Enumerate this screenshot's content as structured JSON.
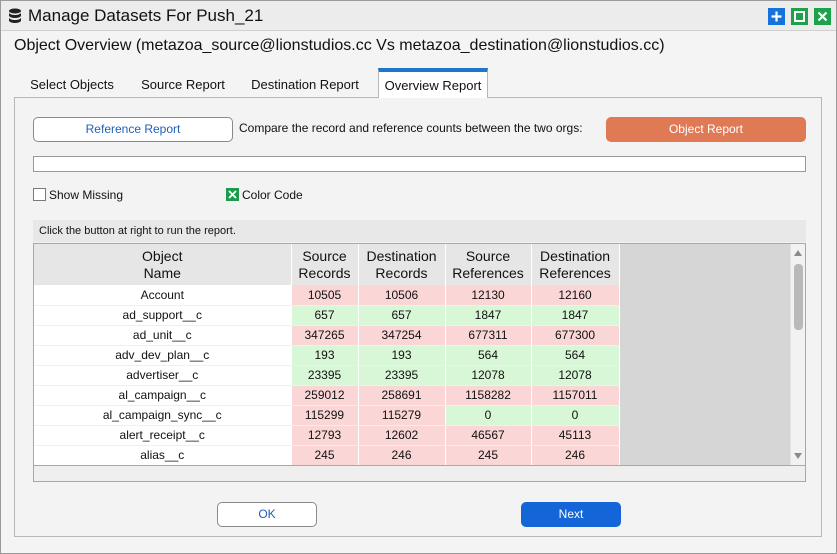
{
  "window": {
    "title": "Manage Datasets For Push_21"
  },
  "header": {
    "title": "Object Overview (metazoa_source@lionstudios.cc Vs metazoa_destination@lionstudios.cc)"
  },
  "tabs": [
    {
      "label": "Select Objects",
      "active": false
    },
    {
      "label": "Source Report",
      "active": false
    },
    {
      "label": "Destination Report",
      "active": false
    },
    {
      "label": "Overview Report",
      "active": true
    }
  ],
  "actions": {
    "reference_report_label": "Reference Report",
    "description": "Compare the record and reference counts between the two orgs:",
    "object_report_label": "Object Report"
  },
  "progress": {
    "value_percent": 0
  },
  "options": {
    "show_missing": {
      "label": "Show Missing",
      "checked": false
    },
    "color_code": {
      "label": "Color Code",
      "checked": true
    }
  },
  "status": {
    "text": "Click the button at right to run the report."
  },
  "table": {
    "columns": [
      {
        "line1": "Object",
        "line2": "Name"
      },
      {
        "line1": "Source",
        "line2": "Records"
      },
      {
        "line1": "Destination",
        "line2": "Records"
      },
      {
        "line1": "Source",
        "line2": "References"
      },
      {
        "line1": "Destination",
        "line2": "References"
      }
    ],
    "rows": [
      {
        "name": "Account",
        "src_rec": "10505",
        "dst_rec": "10506",
        "src_ref": "12130",
        "dst_ref": "12160",
        "rec_match": false,
        "ref_match": false
      },
      {
        "name": "ad_support__c",
        "src_rec": "657",
        "dst_rec": "657",
        "src_ref": "1847",
        "dst_ref": "1847",
        "rec_match": true,
        "ref_match": true
      },
      {
        "name": "ad_unit__c",
        "src_rec": "347265",
        "dst_rec": "347254",
        "src_ref": "677311",
        "dst_ref": "677300",
        "rec_match": false,
        "ref_match": false
      },
      {
        "name": "adv_dev_plan__c",
        "src_rec": "193",
        "dst_rec": "193",
        "src_ref": "564",
        "dst_ref": "564",
        "rec_match": true,
        "ref_match": true
      },
      {
        "name": "advertiser__c",
        "src_rec": "23395",
        "dst_rec": "23395",
        "src_ref": "12078",
        "dst_ref": "12078",
        "rec_match": true,
        "ref_match": true
      },
      {
        "name": "al_campaign__c",
        "src_rec": "259012",
        "dst_rec": "258691",
        "src_ref": "1158282",
        "dst_ref": "1157011",
        "rec_match": false,
        "ref_match": false
      },
      {
        "name": "al_campaign_sync__c",
        "src_rec": "115299",
        "dst_rec": "115279",
        "src_ref": "0",
        "dst_ref": "0",
        "rec_match": false,
        "ref_match": true
      },
      {
        "name": "alert_receipt__c",
        "src_rec": "12793",
        "dst_rec": "12602",
        "src_ref": "46567",
        "dst_ref": "45113",
        "rec_match": false,
        "ref_match": false
      },
      {
        "name": "alias__c",
        "src_rec": "245",
        "dst_rec": "246",
        "src_ref": "245",
        "dst_ref": "246",
        "rec_match": false,
        "ref_match": false
      }
    ]
  },
  "footer": {
    "ok_label": "OK",
    "next_label": "Next"
  },
  "colors": {
    "match": "#d8f7d7",
    "mismatch": "#fbd6d6",
    "accent": "#1466d8",
    "object_report": "#e07a55",
    "tab_active": "#1e76c8",
    "checkbox": "#1f9a4c"
  },
  "icons": {
    "title": "database-icon",
    "add": "plus-icon",
    "maximize": "maximize-icon",
    "close": "close-icon",
    "check": "checkmark-icon"
  }
}
